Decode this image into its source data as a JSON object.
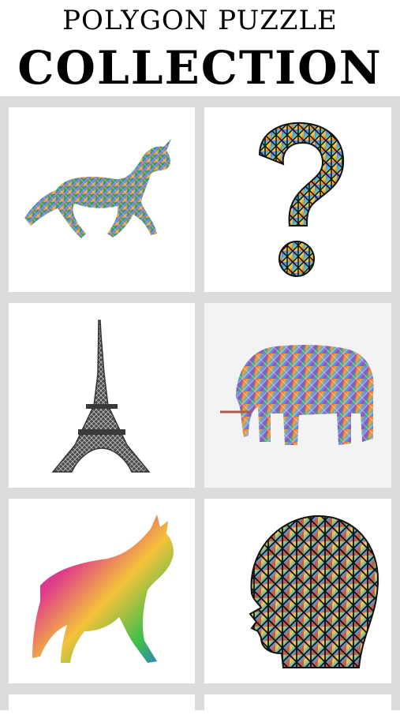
{
  "header": {
    "title_line1": "POLYGON PUZZLE",
    "title_line2": "COLLECTION"
  },
  "puzzles": [
    {
      "icon": "unicorn-icon"
    },
    {
      "icon": "question-mark-icon"
    },
    {
      "icon": "eiffel-tower-icon"
    },
    {
      "icon": "elephant-icon"
    },
    {
      "icon": "wolf-icon"
    },
    {
      "icon": "head-profile-icon"
    }
  ],
  "colors": {
    "background": "#dcdcdc",
    "card": "#ffffff"
  }
}
